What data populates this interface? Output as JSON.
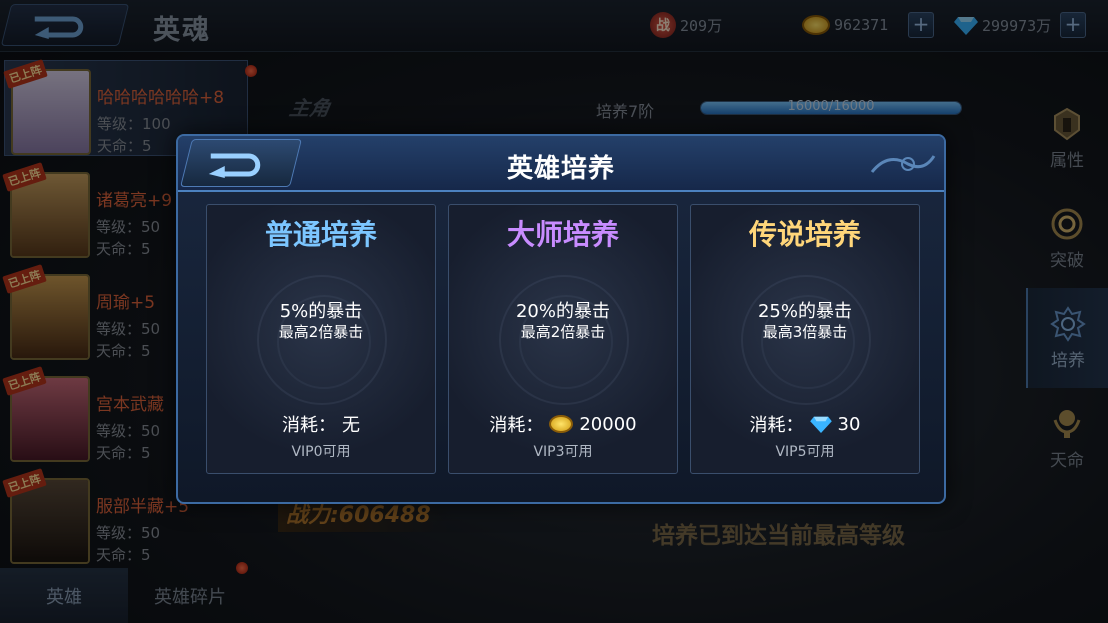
{
  "header": {
    "title": "英魂",
    "zhan_label": "战",
    "battle_value": "209万",
    "gold": "962371",
    "gems": "299973万"
  },
  "hero_list": [
    {
      "tag": "已上阵",
      "name": "哈哈哈哈哈哈+8",
      "level": "等级：100",
      "fate": "天命：5"
    },
    {
      "tag": "已上阵",
      "name": "诸葛亮+9",
      "level": "等级：50",
      "fate": "天命：5"
    },
    {
      "tag": "已上阵",
      "name": "周瑜+5",
      "level": "等级：50",
      "fate": "天命：5"
    },
    {
      "tag": "已上阵",
      "name": "宫本武藏",
      "level": "等级：50",
      "fate": "天命：5"
    },
    {
      "tag": "已上阵",
      "name": "服部半藏+5",
      "level": "等级：50",
      "fate": "天命：5"
    }
  ],
  "bottom_tabs": [
    "英雄",
    "英雄碎片"
  ],
  "center": {
    "main_badge": "主角",
    "train_stage": "培养7阶",
    "train_progress": "16000/16000",
    "train_fraction": 1.0,
    "power": "战力:606488",
    "max_message": "培养已到达当前最高等级"
  },
  "side_menu": [
    "属性",
    "突破",
    "培养",
    "天命"
  ],
  "modal": {
    "title": "英雄培养",
    "cards": [
      {
        "title": "普通培养",
        "crit": "5%的暴击",
        "max": "最高2倍暴击",
        "cost_label": "消耗：",
        "cost_value": "无",
        "vip": "VIP0可用"
      },
      {
        "title": "大师培养",
        "crit": "20%的暴击",
        "max": "最高2倍暴击",
        "cost_label": "消耗：",
        "cost_value": "20000",
        "vip": "VIP3可用"
      },
      {
        "title": "传说培养",
        "crit": "25%的暴击",
        "max": "最高3倍暴击",
        "cost_label": "消耗：",
        "cost_value": "30",
        "vip": "VIP5可用"
      }
    ]
  },
  "icons": {
    "battle": "zhan-badge-icon",
    "gold": "gold-coin-icon",
    "gem": "diamond-icon",
    "back": "back-arrow-icon"
  },
  "colors": {
    "normal": "#7cc6ff",
    "master": "#c88cff",
    "legend": "#ffd67a",
    "hero_name": "#e0643c"
  }
}
